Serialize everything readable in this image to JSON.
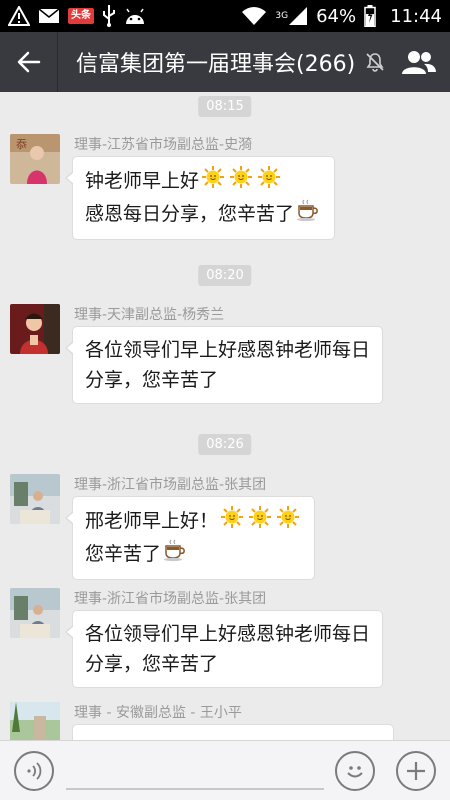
{
  "statusbar": {
    "left_icons": [
      "warning-icon",
      "mail-icon",
      "toutiao-icon",
      "usb-icon",
      "android-icon"
    ],
    "toutiao_label": "头条",
    "network_label": "3G",
    "battery": "64%",
    "time": "11:44"
  },
  "header": {
    "title": "信富集团第一届理事会(266)",
    "muted": true
  },
  "messages": [
    {
      "time": "08:15",
      "sender": "理事-江苏省市场副总监-史漪",
      "lines": [
        "钟老师早上好",
        "感恩每日分享，您辛苦了"
      ],
      "line_emojis": [
        [
          "sun-emoji",
          "sun-emoji",
          "sun-emoji"
        ],
        [
          "coffee-emoji"
        ]
      ]
    },
    {
      "time": "08:20",
      "sender": "理事-天津副总监-杨秀兰",
      "lines": [
        "各位领导们早上好感恩钟老师每日",
        "分享，您辛苦了"
      ],
      "line_emojis": [
        [],
        []
      ]
    },
    {
      "time": "08:26",
      "sender": "理事-浙江省市场副总监-张其团",
      "lines": [
        "邢老师早上好！",
        "您辛苦了"
      ],
      "line_emojis": [
        [
          "sun-emoji",
          "sun-emoji",
          "sun-emoji"
        ],
        [
          "coffee-emoji"
        ]
      ]
    },
    {
      "time": "",
      "sender": "理事-浙江省市场副总监-张其团",
      "lines": [
        "各位领导们早上好感恩钟老师每日",
        "分享，您辛苦了"
      ],
      "line_emojis": [
        [],
        []
      ]
    },
    {
      "time": "",
      "sender": "理事 - 安徽副总监 - 王小平",
      "lines": [],
      "line_emojis": []
    }
  ],
  "colors": {
    "titlebar": "#393a3f",
    "chat_bg": "#ebebeb",
    "sender_text": "#9a9a9a",
    "time_chip": "#d5d5d5",
    "accent_red": "#e23b3b"
  }
}
